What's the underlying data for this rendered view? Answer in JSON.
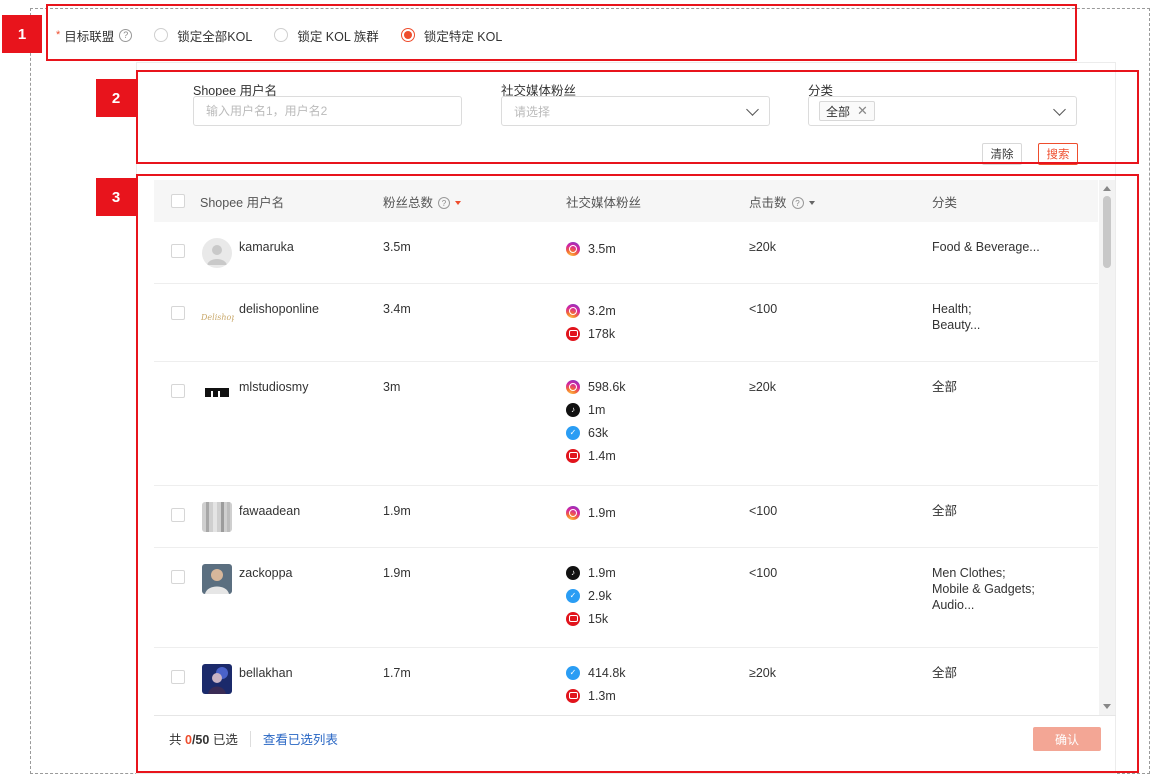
{
  "target": {
    "label": "目标联盟",
    "required_mark": "*",
    "help_icon": "?",
    "options": [
      {
        "label": "锁定全部KOL",
        "selected": false
      },
      {
        "label": "锁定 KOL 族群",
        "selected": false
      },
      {
        "label": "锁定特定 KOL",
        "selected": true
      }
    ]
  },
  "filters": {
    "username_label": "Shopee 用户名",
    "username_placeholder": "输入用户名1，用户名2",
    "social_label": "社交媒体粉丝",
    "social_placeholder": "请选择",
    "category_label": "分类",
    "category_tag": "全部",
    "clear_label": "清除",
    "search_label": "搜索"
  },
  "callouts": [
    "1",
    "2",
    "3"
  ],
  "table": {
    "headers": {
      "username": "Shopee 用户名",
      "followers": "粉丝总数",
      "social": "社交媒体粉丝",
      "clicks": "点击数",
      "category": "分类"
    },
    "help_icon": "?",
    "rows": [
      {
        "username": "kamaruka",
        "followers": "3.5m",
        "social": [
          {
            "icon": "instagram-icon",
            "value": "3.5m"
          }
        ],
        "clicks": "≥20k",
        "category": [
          "Food & Beverage..."
        ]
      },
      {
        "username": "delishoponline",
        "avatar_text": "Delishop",
        "followers": "3.4m",
        "social": [
          {
            "icon": "instagram-icon",
            "value": "3.2m"
          },
          {
            "icon": "youtube-icon",
            "value": "178k"
          }
        ],
        "clicks": "<100",
        "category": [
          "Health;",
          "Beauty..."
        ]
      },
      {
        "username": "mlstudiosmy",
        "followers": "3m",
        "social": [
          {
            "icon": "instagram-icon",
            "value": "598.6k"
          },
          {
            "icon": "tiktok-icon",
            "value": "1m"
          },
          {
            "icon": "twitter-icon",
            "value": "63k"
          },
          {
            "icon": "youtube-icon",
            "value": "1.4m"
          }
        ],
        "clicks": "≥20k",
        "category": [
          "全部"
        ]
      },
      {
        "username": "fawaadean",
        "followers": "1.9m",
        "social": [
          {
            "icon": "instagram-icon",
            "value": "1.9m"
          }
        ],
        "clicks": "<100",
        "category": [
          "全部"
        ]
      },
      {
        "username": "zackoppa",
        "followers": "1.9m",
        "social": [
          {
            "icon": "tiktok-icon",
            "value": "1.9m"
          },
          {
            "icon": "twitter-icon",
            "value": "2.9k"
          },
          {
            "icon": "youtube-icon",
            "value": "15k"
          }
        ],
        "clicks": "<100",
        "category": [
          "Men Clothes;",
          "Mobile & Gadgets;",
          "Audio..."
        ]
      },
      {
        "username": "bellakhan",
        "followers": "1.7m",
        "social": [
          {
            "icon": "twitter-icon",
            "value": "414.8k"
          },
          {
            "icon": "youtube-icon",
            "value": "1.3m"
          }
        ],
        "clicks": "≥20k",
        "category": [
          "全部"
        ]
      }
    ]
  },
  "footer": {
    "prefix": "共",
    "selected": "0",
    "total": "/50",
    "suffix": "已选",
    "view_link": "查看已选列表",
    "confirm_label": "确认"
  },
  "colors": {
    "accent": "#ee4d2d",
    "callout": "#e8141c",
    "link": "#2866c4"
  }
}
